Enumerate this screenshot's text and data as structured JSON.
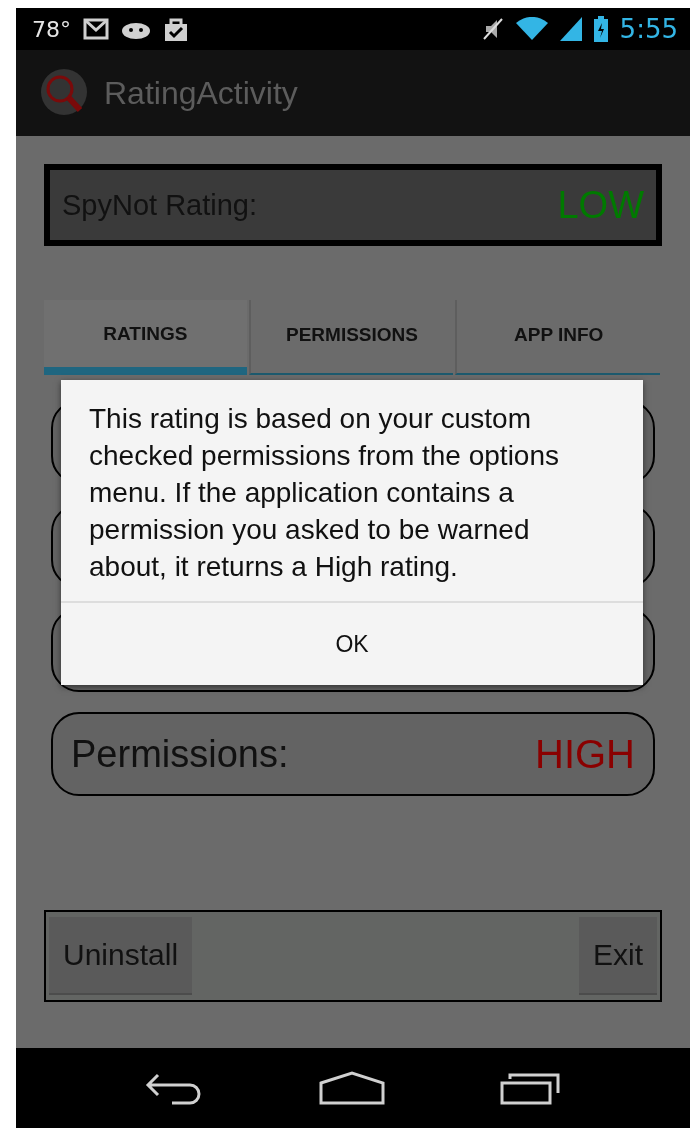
{
  "status_bar": {
    "temperature": "78°",
    "time": "5:55"
  },
  "action_bar": {
    "title": "RatingActivity"
  },
  "rating": {
    "label": "SpyNot Rating:",
    "value": "LOW",
    "color": "#007a00"
  },
  "tabs": [
    {
      "label": "RATINGS",
      "selected": true
    },
    {
      "label": "PERMISSIONS",
      "selected": false
    },
    {
      "label": "APP INFO",
      "selected": false
    }
  ],
  "rows": [
    {
      "label": "Permissions:",
      "value": "HIGH",
      "color": "#8a0000"
    }
  ],
  "dialog": {
    "message": "This rating is based on your custom checked permissions from the options menu. If the application contains a permission you asked to be warned about, it returns a High rating.",
    "button": "OK"
  },
  "buttons": [
    "Uninstall",
    "Exit"
  ]
}
